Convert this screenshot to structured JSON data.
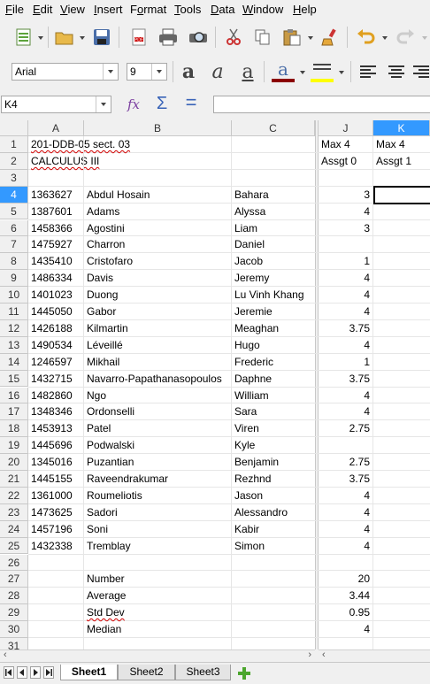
{
  "menu": [
    "File",
    "Edit",
    "View",
    "Insert",
    "Format",
    "Tools",
    "Data",
    "Window",
    "Help"
  ],
  "menu_underline": [
    "F",
    "E",
    "V",
    "I",
    "o",
    "T",
    "D",
    "W",
    "H"
  ],
  "toolbar2": {
    "font_name": "Arial",
    "font_size": "9",
    "bold_glyph": "a",
    "italic_glyph": "a",
    "underline_glyph": "a",
    "fontcolor_glyph": "a"
  },
  "formula_bar": {
    "cell_ref": "K4",
    "function_glyph": "fx",
    "sum_glyph": "Σ",
    "equals_glyph": "=",
    "content": ""
  },
  "columns": [
    "A",
    "B",
    "C",
    "J",
    "K"
  ],
  "rows": [
    {
      "n": "1",
      "A": "201-DDB-05 sect. 03",
      "B": "",
      "C": "",
      "J": "Max 4",
      "K": "Max 4"
    },
    {
      "n": "2",
      "A": "CALCULUS III",
      "B": "",
      "C": "",
      "J": "Assgt 0",
      "K": "Assgt 1"
    },
    {
      "n": "3",
      "A": "",
      "B": "",
      "C": "",
      "J": "",
      "K": ""
    },
    {
      "n": "4",
      "A": "1363627",
      "B": "Abdul Hosain",
      "C": "Bahara",
      "J": "3",
      "K": ""
    },
    {
      "n": "5",
      "A": "1387601",
      "B": "Adams",
      "C": "Alyssa",
      "J": "4",
      "K": ""
    },
    {
      "n": "6",
      "A": "1458366",
      "B": "Agostini",
      "C": "Liam",
      "J": "3",
      "K": ""
    },
    {
      "n": "7",
      "A": "1475927",
      "B": "Charron",
      "C": "Daniel",
      "J": "",
      "K": ""
    },
    {
      "n": "8",
      "A": "1435410",
      "B": "Cristofaro",
      "C": "Jacob",
      "J": "1",
      "K": ""
    },
    {
      "n": "9",
      "A": "1486334",
      "B": "Davis",
      "C": "Jeremy",
      "J": "4",
      "K": ""
    },
    {
      "n": "10",
      "A": "1401023",
      "B": "Duong",
      "C": "Lu Vinh Khang",
      "J": "4",
      "K": ""
    },
    {
      "n": "11",
      "A": "1445050",
      "B": "Gabor",
      "C": "Jeremie",
      "J": "4",
      "K": ""
    },
    {
      "n": "12",
      "A": "1426188",
      "B": "Kilmartin",
      "C": "Meaghan",
      "J": "3.75",
      "K": ""
    },
    {
      "n": "13",
      "A": "1490534",
      "B": "Léveillé",
      "C": "Hugo",
      "J": "4",
      "K": ""
    },
    {
      "n": "14",
      "A": "1246597",
      "B": "Mikhail",
      "C": "Frederic",
      "J": "1",
      "K": ""
    },
    {
      "n": "15",
      "A": "1432715",
      "B": "Navarro-Papathanasopoulos",
      "C": "Daphne",
      "J": "3.75",
      "K": ""
    },
    {
      "n": "16",
      "A": "1482860",
      "B": "Ngo",
      "C": "William",
      "J": "4",
      "K": ""
    },
    {
      "n": "17",
      "A": "1348346",
      "B": "Ordonselli",
      "C": "Sara",
      "J": "4",
      "K": ""
    },
    {
      "n": "18",
      "A": "1453913",
      "B": "Patel",
      "C": "Viren",
      "J": "2.75",
      "K": ""
    },
    {
      "n": "19",
      "A": "1445696",
      "B": "Podwalski",
      "C": "Kyle",
      "J": "",
      "K": ""
    },
    {
      "n": "20",
      "A": "1345016",
      "B": "Puzantian",
      "C": "Benjamin",
      "J": "2.75",
      "K": ""
    },
    {
      "n": "21",
      "A": "1445155",
      "B": "Raveendrakumar",
      "C": "Rezhnd",
      "J": "3.75",
      "K": ""
    },
    {
      "n": "22",
      "A": "1361000",
      "B": "Roumeliotis",
      "C": "Jason",
      "J": "4",
      "K": ""
    },
    {
      "n": "23",
      "A": "1473625",
      "B": "Sadori",
      "C": "Alessandro",
      "J": "4",
      "K": ""
    },
    {
      "n": "24",
      "A": "1457196",
      "B": "Soni",
      "C": "Kabir",
      "J": "4",
      "K": ""
    },
    {
      "n": "25",
      "A": "1432338",
      "B": "Tremblay",
      "C": "Simon",
      "J": "4",
      "K": ""
    },
    {
      "n": "26",
      "A": "",
      "B": "",
      "C": "",
      "J": "",
      "K": ""
    },
    {
      "n": "27",
      "A": "",
      "B": "Number",
      "C": "",
      "J": "20",
      "K": ""
    },
    {
      "n": "28",
      "A": "",
      "B": "Average",
      "C": "",
      "J": "3.44",
      "K": ""
    },
    {
      "n": "29",
      "A": "",
      "B": "Std Dev",
      "C": "",
      "J": "0.95",
      "K": ""
    },
    {
      "n": "30",
      "A": "",
      "B": "Median",
      "C": "",
      "J": "4",
      "K": ""
    },
    {
      "n": "31",
      "A": "",
      "B": "",
      "C": "",
      "J": "",
      "K": ""
    }
  ],
  "selected_cell": "K4",
  "sheet_tabs": [
    "Sheet1",
    "Sheet2",
    "Sheet3"
  ],
  "active_sheet": "Sheet1",
  "colors": {
    "selection": "#3399ff",
    "spell": "#d00000"
  }
}
